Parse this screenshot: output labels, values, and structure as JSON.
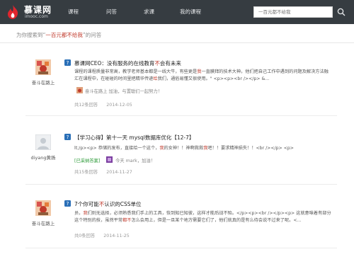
{
  "header": {
    "logo_cn": "慕课网",
    "logo_en": "imooc.com",
    "nav": [
      "课程",
      "问答",
      "求课",
      "我的课程"
    ],
    "search_placeholder": "一百元都不给我"
  },
  "search_result": {
    "prefix": "为你搜索到“",
    "keyword": "一百元都不给我",
    "suffix": "”的问答"
  },
  "items": [
    {
      "username": "奋斗在路上",
      "title_before": "慕课网CEO：没有服务的在线教育",
      "title_hl": "不",
      "title_after": "会有未来",
      "body_1": "课程的课程质量非常高，教学老师基本都是一线大牛，有些更是",
      "body_hl1": "我",
      "body_2": "一直膜拜的技术大神。他们把自己工作中遇到的问题及解决方法融汇在课程中，在碰碰的时间里把精华传递",
      "body_hl2": "给",
      "body_3": "我们，通俗易懂又很使用。\" <p><p><br /></p> &...",
      "reply_user": "奋斗在路上",
      "reply_text": "加油，与置聪们一起努力！",
      "answers": "共12条回答",
      "date": "2014-12-05"
    },
    {
      "username": "diyang黄扬",
      "title_before": "【学习心得】第十一天 mysql数据库优化【12-7】",
      "body_1": "lt;/p><p>     恭储的发布，直接给一个这个，",
      "body_hl1": "我",
      "body_2": "的女神！！神啊救救",
      "body_hl2": "我",
      "body_3": "吧！！要求精神损失！！<br /></p> <p>",
      "adopted": "[已采纳答案]",
      "reply_text": "今天 mark，加油！",
      "answers": "共15条回答",
      "date": "2014-11-27"
    },
    {
      "username": "奋斗在路上",
      "title_before": "7个你可能",
      "title_hl": "不",
      "title_after": "认识的CSS单位",
      "body_1": "员，",
      "body_hl1": "我",
      "body_2": "们则无选择，必须熟悉我们手上的工具，恢到知已知彼，这样才能后战不殆。</p><p><br /></p><p>     这就意味着有部分这个特别的技，虽然平常",
      "body_hl2": "都不",
      "body_3": "怎么会用上，但是一旦某个地方需要它们了，他们就真的是有么待会说不过来了呢。<...",
      "answers": "共0条回答",
      "date": "2014-11-25"
    }
  ],
  "colors": {
    "topbar": "#363c41",
    "accent": "#c0392b",
    "adopted": "#2e9b3a"
  }
}
